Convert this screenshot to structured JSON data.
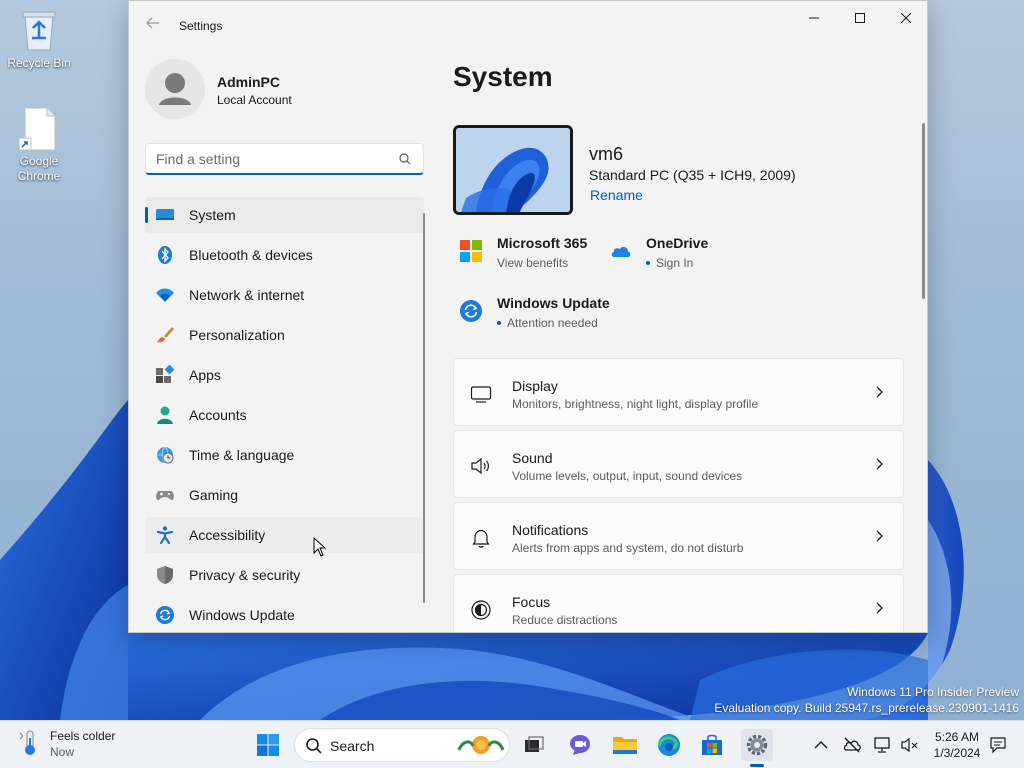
{
  "desktop": {
    "icons": [
      {
        "label": "Recycle Bin",
        "icon": "recycle-bin-icon"
      },
      {
        "label": "Google Chrome",
        "icon": "shortcut-file-icon"
      }
    ],
    "watermark": {
      "line1": "Windows 11 Pro Insider Preview",
      "line2": "Evaluation copy. Build 25947.rs_prerelease.230901-1416"
    }
  },
  "window": {
    "title": "Settings",
    "user": {
      "name": "AdminPC",
      "account_type": "Local Account"
    },
    "search": {
      "placeholder": "Find a setting",
      "value": ""
    },
    "nav": [
      {
        "label": "System",
        "icon": "system-icon",
        "selected": true
      },
      {
        "label": "Bluetooth & devices",
        "icon": "bluetooth-icon"
      },
      {
        "label": "Network & internet",
        "icon": "wifi-icon"
      },
      {
        "label": "Personalization",
        "icon": "brush-icon"
      },
      {
        "label": "Apps",
        "icon": "apps-icon"
      },
      {
        "label": "Accounts",
        "icon": "accounts-icon"
      },
      {
        "label": "Time & language",
        "icon": "globe-clock-icon"
      },
      {
        "label": "Gaming",
        "icon": "gamepad-icon"
      },
      {
        "label": "Accessibility",
        "icon": "accessibility-icon",
        "hovered": true
      },
      {
        "label": "Privacy & security",
        "icon": "shield-icon"
      },
      {
        "label": "Windows Update",
        "icon": "windows-update-icon"
      }
    ],
    "main": {
      "title": "System",
      "device": {
        "name": "vm6",
        "model": "Standard PC (Q35 + ICH9, 2009)",
        "rename": "Rename"
      },
      "tiles": [
        {
          "title": "Microsoft 365",
          "subtitle": "View benefits",
          "icon": "microsoft-365-icon",
          "dot": false
        },
        {
          "title": "OneDrive",
          "subtitle": "Sign In",
          "icon": "onedrive-icon",
          "dot": true
        },
        {
          "title": "Windows Update",
          "subtitle": "Attention needed",
          "icon": "windows-update-icon",
          "dot": true
        }
      ],
      "cards": [
        {
          "title": "Display",
          "subtitle": "Monitors, brightness, night light, display profile",
          "icon": "display-icon"
        },
        {
          "title": "Sound",
          "subtitle": "Volume levels, output, input, sound devices",
          "icon": "speaker-icon"
        },
        {
          "title": "Notifications",
          "subtitle": "Alerts from apps and system, do not disturb",
          "icon": "bell-icon"
        },
        {
          "title": "Focus",
          "subtitle": "Reduce distractions",
          "icon": "focus-icon"
        }
      ]
    }
  },
  "taskbar": {
    "weather": {
      "title": "Feels colder",
      "subtitle": "Now"
    },
    "search_label": "Search",
    "clock": {
      "time": "5:26 AM",
      "date": "1/3/2024"
    }
  },
  "colors": {
    "accent": "#005fb8",
    "window_bg": "#f3f3f3",
    "card_bg": "#fbfbfb"
  }
}
